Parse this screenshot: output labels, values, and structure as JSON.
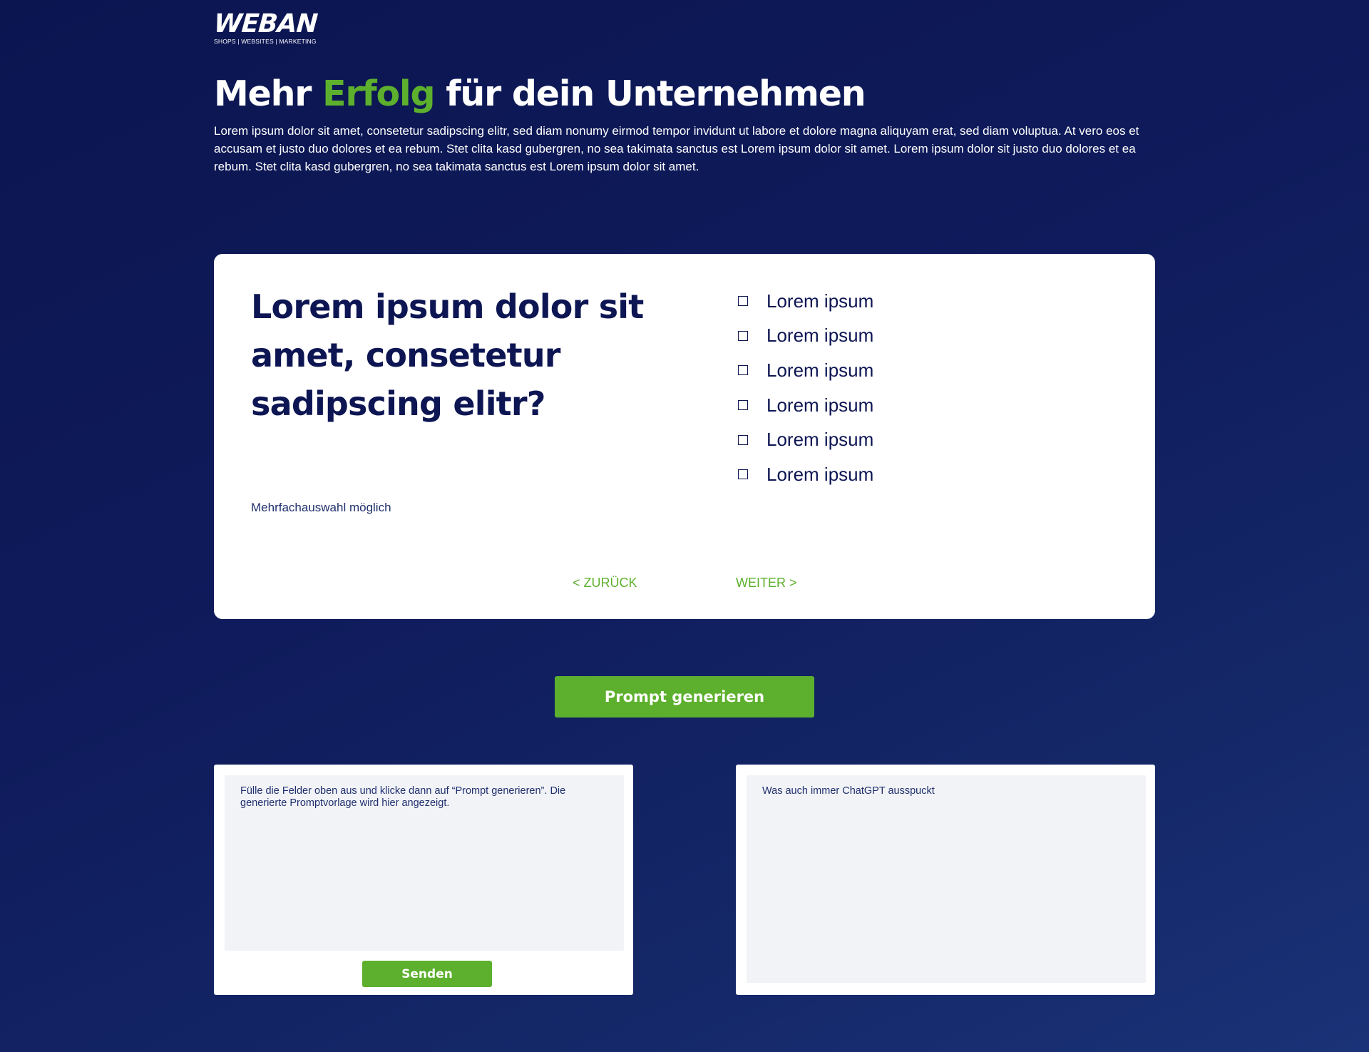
{
  "brand": {
    "name": "WEBAN",
    "tagline": "SHOPS | WEBSITES | MARKETING"
  },
  "hero": {
    "title_before": "Mehr ",
    "title_accent": "Erfolg",
    "title_after": " für dein Unternehmen",
    "text": "Lorem ipsum dolor sit amet, consetetur sadipscing elitr, sed diam nonumy eirmod tempor invidunt ut labore et dolore magna aliquyam erat, sed diam voluptua. At vero eos et accusam et justo duo dolores et ea rebum. Stet clita kasd gubergren, no sea takimata sanctus est Lorem ipsum dolor sit amet. Lorem ipsum dolor sit justo duo dolores et ea rebum. Stet clita kasd gubergren, no sea takimata sanctus est Lorem ipsum dolor sit amet."
  },
  "quiz": {
    "question": "Lorem ipsum dolor sit amet, consetetur sadipscing elitr?",
    "hint": "Mehrfachauswahl möglich",
    "options": [
      {
        "label": "Lorem ipsum",
        "checked": false
      },
      {
        "label": "Lorem ipsum",
        "checked": false
      },
      {
        "label": "Lorem ipsum",
        "checked": false
      },
      {
        "label": "Lorem ipsum",
        "checked": false
      },
      {
        "label": "Lorem ipsum",
        "checked": false
      },
      {
        "label": "Lorem ipsum",
        "checked": false
      }
    ],
    "back_label": "< ZURÜCK",
    "next_label": "WEITER >"
  },
  "generate": {
    "label": "Prompt generieren"
  },
  "prompt_panel": {
    "text": "Fülle die Felder oben aus und klicke dann auf “Prompt generieren”. Die generierte Promptvorlage wird hier angezeigt.",
    "send_label": "Senden"
  },
  "response_panel": {
    "text": "Was auch immer ChatGPT ausspuckt"
  },
  "colors": {
    "accent": "#5db02d",
    "navy": "#0d1653",
    "background": "#0f1b5c"
  }
}
